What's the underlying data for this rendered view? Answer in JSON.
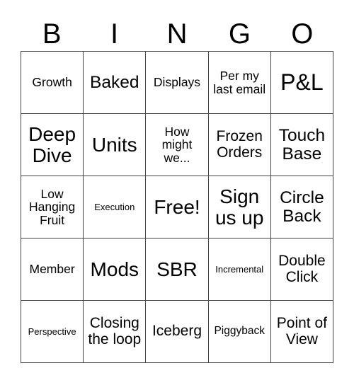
{
  "card": {
    "title_letters": [
      "B",
      "I",
      "N",
      "G",
      "O"
    ],
    "free_space_text": "Free!",
    "columns": 5,
    "rows": 5,
    "border_color": "#444444",
    "text_color": "#000000",
    "background_color": "#ffffff",
    "grid": [
      [
        {
          "text": "Growth",
          "size": "m"
        },
        {
          "text": "Baked",
          "size": "xl"
        },
        {
          "text": "Displays",
          "size": "m"
        },
        {
          "text": "Per my last email",
          "size": "m"
        },
        {
          "text": "P&L",
          "size": "huge"
        }
      ],
      [
        {
          "text": "Deep Dive",
          "size": "xxl"
        },
        {
          "text": "Units",
          "size": "xxl"
        },
        {
          "text": "How might we...",
          "size": "m"
        },
        {
          "text": "Frozen Orders",
          "size": "l"
        },
        {
          "text": "Touch Base",
          "size": "xl"
        }
      ],
      [
        {
          "text": "Low Hanging Fruit",
          "size": "m"
        },
        {
          "text": "Execution",
          "size": "xs"
        },
        {
          "text": "Free!",
          "size": "xxl"
        },
        {
          "text": "Sign us up",
          "size": "xxl"
        },
        {
          "text": "Circle Back",
          "size": "xl"
        }
      ],
      [
        {
          "text": "Member",
          "size": "m"
        },
        {
          "text": "Mods",
          "size": "xxl"
        },
        {
          "text": "SBR",
          "size": "xxl"
        },
        {
          "text": "Incremental",
          "size": "xs"
        },
        {
          "text": "Double Click",
          "size": "l"
        }
      ],
      [
        {
          "text": "Perspective",
          "size": "xs"
        },
        {
          "text": "Closing the loop",
          "size": "l"
        },
        {
          "text": "Iceberg",
          "size": "l"
        },
        {
          "text": "Piggyback",
          "size": "s"
        },
        {
          "text": "Point of View",
          "size": "l"
        }
      ]
    ]
  }
}
